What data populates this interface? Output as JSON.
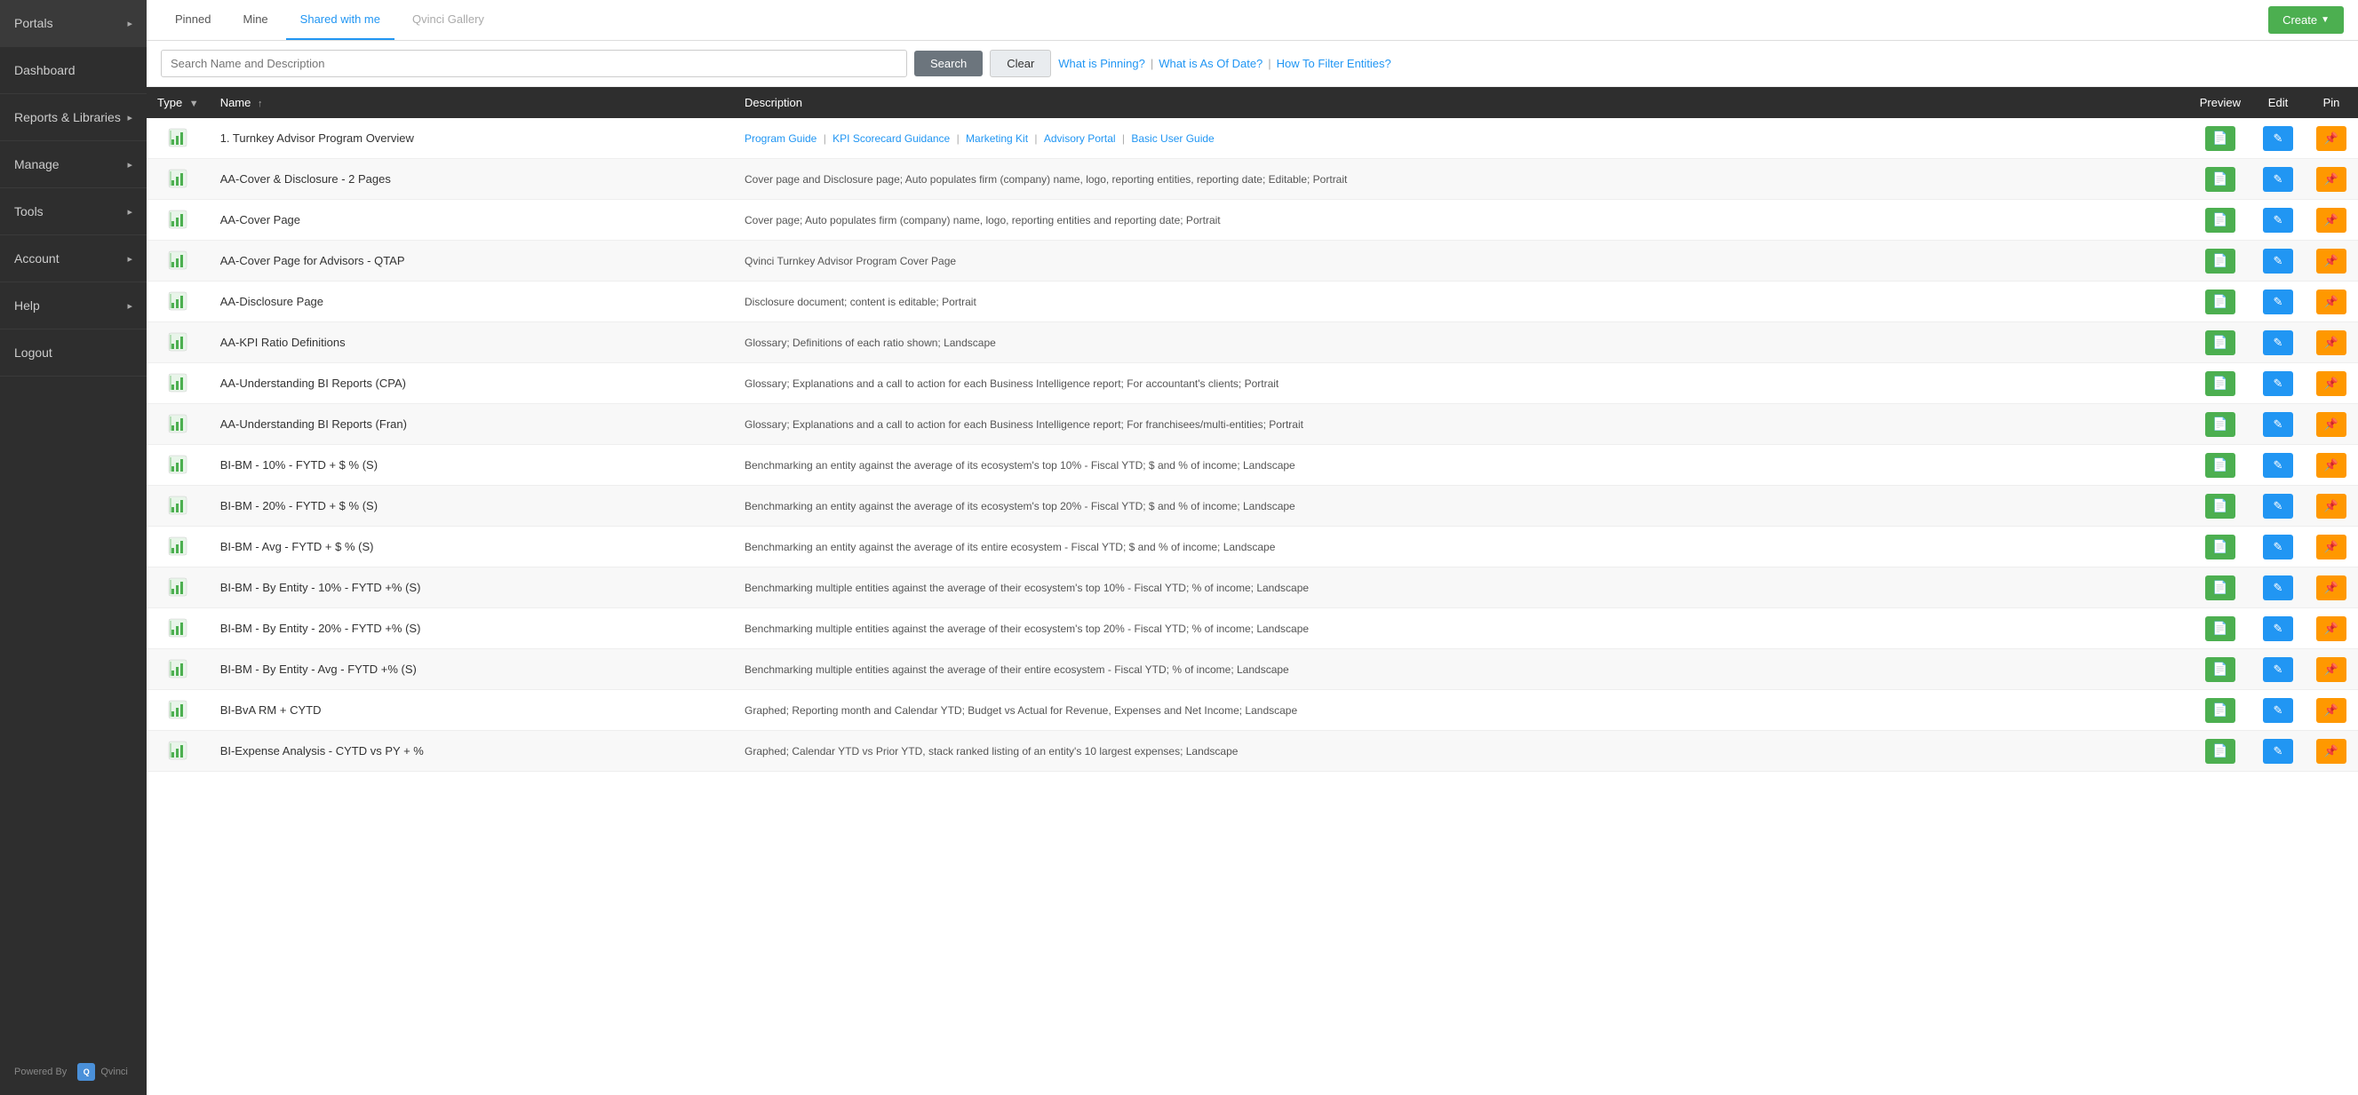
{
  "sidebar": {
    "items": [
      {
        "label": "Portals",
        "hasChevron": true,
        "id": "portals"
      },
      {
        "label": "Dashboard",
        "hasChevron": false,
        "id": "dashboard"
      },
      {
        "label": "Reports & Libraries",
        "hasChevron": true,
        "id": "reports-libraries"
      },
      {
        "label": "Manage",
        "hasChevron": true,
        "id": "manage"
      },
      {
        "label": "Tools",
        "hasChevron": true,
        "id": "tools"
      },
      {
        "label": "Account",
        "hasChevron": true,
        "id": "account"
      },
      {
        "label": "Help",
        "hasChevron": true,
        "id": "help"
      },
      {
        "label": "Logout",
        "hasChevron": false,
        "id": "logout"
      }
    ],
    "footer": {
      "powered_by": "Powered By",
      "brand": "Qvinci"
    }
  },
  "tabs": [
    {
      "label": "Pinned",
      "active": false,
      "disabled": false,
      "id": "tab-pinned"
    },
    {
      "label": "Mine",
      "active": false,
      "disabled": false,
      "id": "tab-mine"
    },
    {
      "label": "Shared with me",
      "active": true,
      "disabled": false,
      "id": "tab-shared"
    },
    {
      "label": "Qvinci Gallery",
      "active": false,
      "disabled": true,
      "id": "tab-gallery"
    }
  ],
  "create_button": "Create",
  "search": {
    "placeholder": "Search Name and Description",
    "search_label": "Search",
    "clear_label": "Clear"
  },
  "help_links": [
    {
      "label": "What is Pinning?",
      "id": "link-pinning"
    },
    {
      "label": "What is As Of Date?",
      "id": "link-asofdate"
    },
    {
      "label": "How To Filter Entities?",
      "id": "link-filter"
    }
  ],
  "table": {
    "headers": [
      {
        "label": "Type",
        "id": "col-type"
      },
      {
        "label": "Name",
        "id": "col-name"
      },
      {
        "label": "Description",
        "id": "col-description"
      },
      {
        "label": "Preview",
        "id": "col-preview"
      },
      {
        "label": "Edit",
        "id": "col-edit"
      },
      {
        "label": "Pin",
        "id": "col-pin"
      }
    ],
    "rows": [
      {
        "name": "1. Turnkey Advisor Program Overview",
        "desc_links": [
          "Program Guide",
          "KPI Scorecard Guidance",
          "Marketing Kit",
          "Advisory Portal",
          "Basic User Guide"
        ],
        "desc_plain": ""
      },
      {
        "name": "AA-Cover & Disclosure - 2 Pages",
        "desc_links": [],
        "desc_plain": "Cover page and Disclosure page; Auto populates firm (company) name, logo, reporting entities, reporting date; Editable; Portrait"
      },
      {
        "name": "AA-Cover Page",
        "desc_links": [],
        "desc_plain": "Cover page; Auto populates firm (company) name, logo, reporting entities and reporting date; Portrait"
      },
      {
        "name": "AA-Cover Page for Advisors - QTAP",
        "desc_links": [],
        "desc_plain": "Qvinci Turnkey Advisor Program Cover Page"
      },
      {
        "name": "AA-Disclosure Page",
        "desc_links": [],
        "desc_plain": "Disclosure document; content is editable; Portrait"
      },
      {
        "name": "AA-KPI Ratio Definitions",
        "desc_links": [],
        "desc_plain": "Glossary; Definitions of each ratio shown; Landscape"
      },
      {
        "name": "AA-Understanding BI Reports (CPA)",
        "desc_links": [],
        "desc_plain": "Glossary; Explanations and a call to action for each Business Intelligence report; For accountant's clients; Portrait"
      },
      {
        "name": "AA-Understanding BI Reports (Fran)",
        "desc_links": [],
        "desc_plain": "Glossary; Explanations and a call to action for each Business Intelligence report; For franchisees/multi-entities; Portrait"
      },
      {
        "name": "BI-BM - 10% - FYTD + $ % (S)",
        "desc_links": [],
        "desc_plain": "Benchmarking an entity against the average of its ecosystem's top 10% - Fiscal YTD; $ and % of income; Landscape"
      },
      {
        "name": "BI-BM - 20% - FYTD + $ % (S)",
        "desc_links": [],
        "desc_plain": "Benchmarking an entity against the average of its ecosystem's top 20% - Fiscal YTD; $ and % of income; Landscape"
      },
      {
        "name": "BI-BM - Avg - FYTD + $ % (S)",
        "desc_links": [],
        "desc_plain": "Benchmarking an entity against the average of its entire ecosystem - Fiscal YTD; $ and % of income; Landscape"
      },
      {
        "name": "BI-BM - By Entity - 10% - FYTD +% (S)",
        "desc_links": [],
        "desc_plain": "Benchmarking multiple entities against the average of their ecosystem's top 10% - Fiscal YTD; % of income; Landscape"
      },
      {
        "name": "BI-BM - By Entity - 20% - FYTD +% (S)",
        "desc_links": [],
        "desc_plain": "Benchmarking multiple entities against the average of their ecosystem's top 20% - Fiscal YTD; % of income; Landscape"
      },
      {
        "name": "BI-BM - By Entity - Avg - FYTD +% (S)",
        "desc_links": [],
        "desc_plain": "Benchmarking multiple entities against the average of their entire ecosystem - Fiscal YTD; % of income; Landscape"
      },
      {
        "name": "BI-BvA RM + CYTD",
        "desc_links": [],
        "desc_plain": "Graphed; Reporting month and Calendar YTD; Budget vs Actual for Revenue, Expenses and Net Income; Landscape"
      },
      {
        "name": "BI-Expense Analysis - CYTD vs PY + %",
        "desc_links": [],
        "desc_plain": "Graphed; Calendar YTD vs Prior YTD, stack ranked listing of an entity's 10 largest expenses; Landscape"
      }
    ]
  }
}
